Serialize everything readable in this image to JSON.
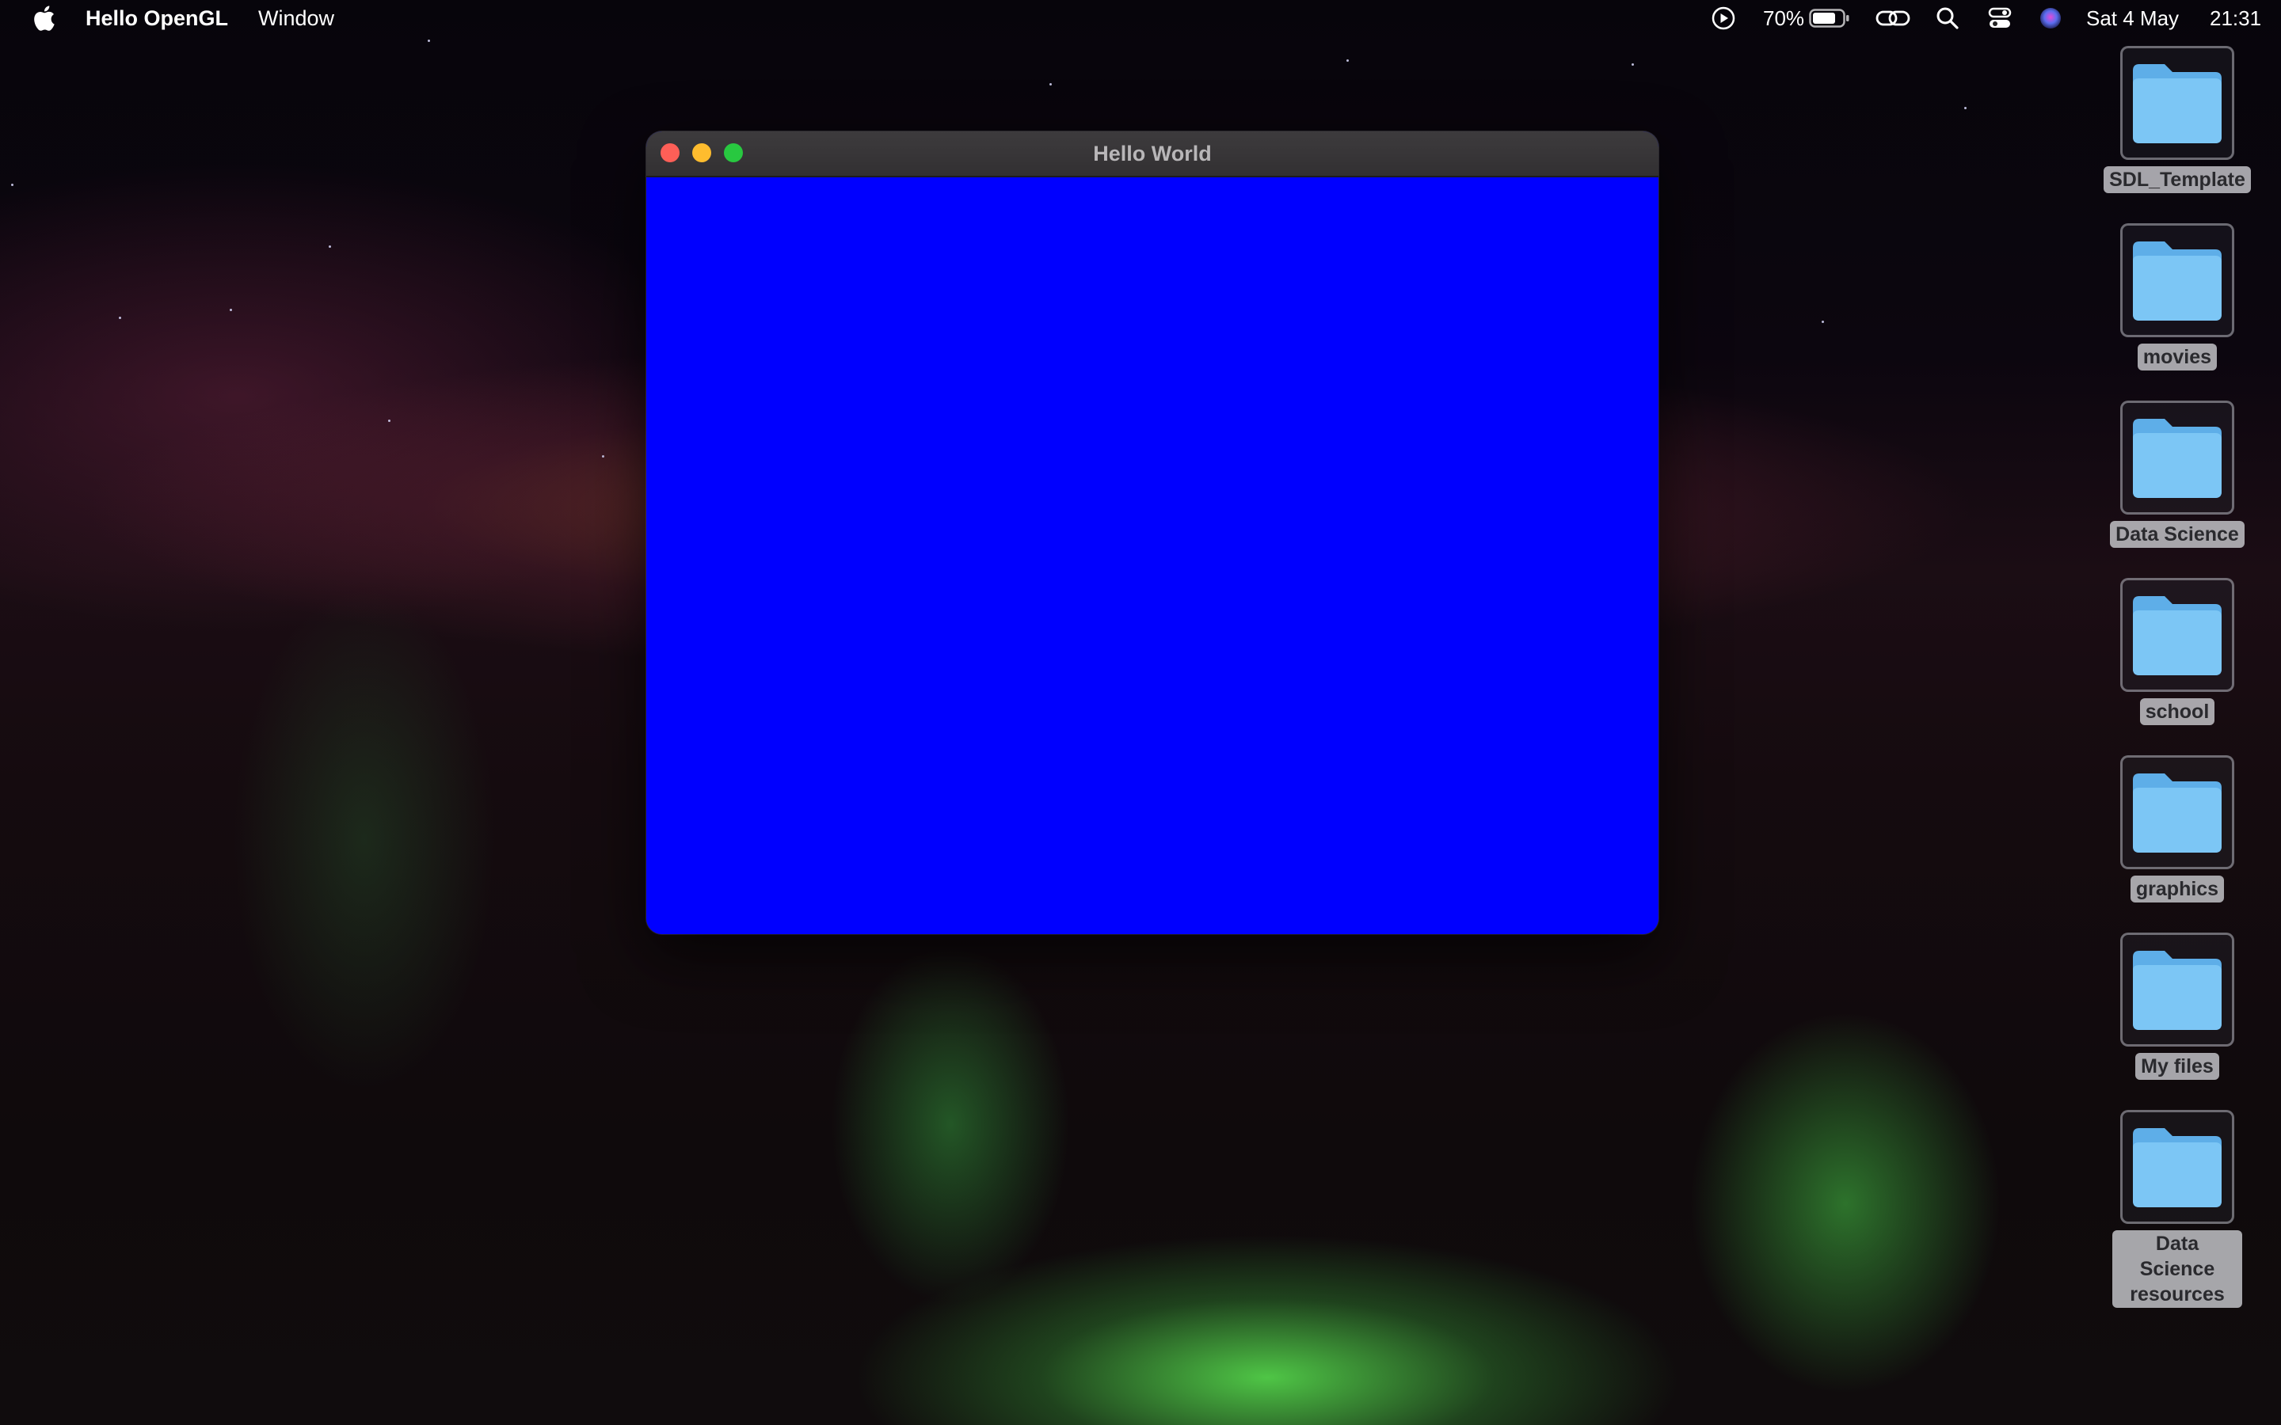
{
  "menubar": {
    "app_name": "Hello OpenGL",
    "menus": [
      "Window"
    ],
    "battery_percent": "70%",
    "date": "Sat 4 May",
    "time": "21:31"
  },
  "window": {
    "title": "Hello World",
    "canvas_color": "#0000ff"
  },
  "desktop": {
    "items": [
      {
        "label": "SDL_Template"
      },
      {
        "label": "movies"
      },
      {
        "label": "Data Science"
      },
      {
        "label": "school"
      },
      {
        "label": "graphics"
      },
      {
        "label": "My files"
      },
      {
        "label": "Data Science resources"
      }
    ]
  },
  "colors": {
    "close": "#fe5f57",
    "minimize": "#febc2e",
    "maximize": "#28c840",
    "folder": "#79c4f4"
  },
  "icons": [
    "apple-icon",
    "play-icon",
    "battery-icon",
    "link-icon",
    "search-icon",
    "control-center-icon",
    "siri-icon",
    "folder-icon"
  ]
}
